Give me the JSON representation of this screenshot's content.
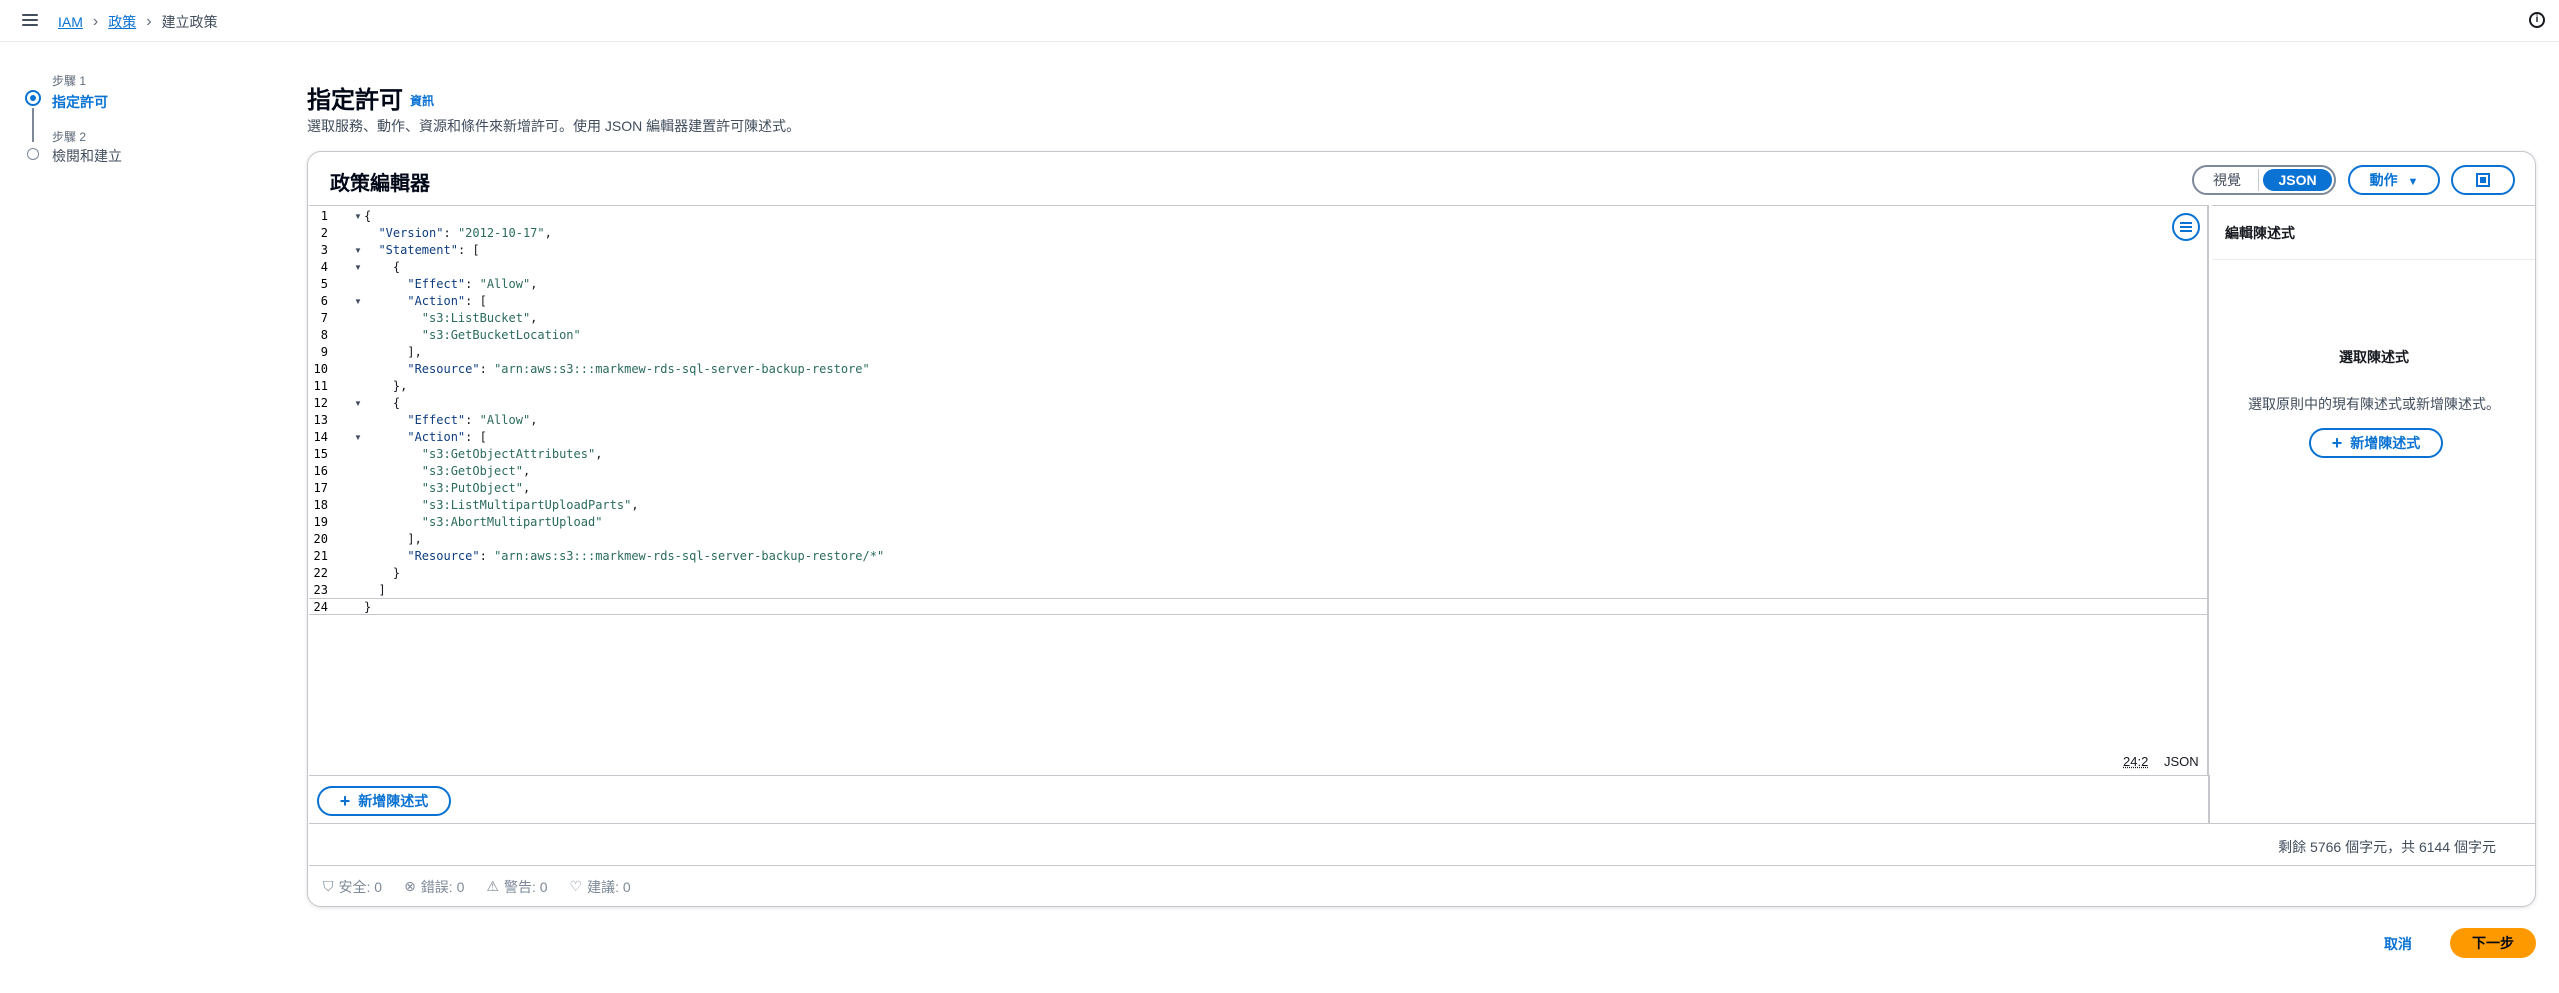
{
  "breadcrumbs": [
    "IAM",
    "政策",
    "建立政策"
  ],
  "steps": [
    {
      "num": "步驟 1",
      "title": "指定許可"
    },
    {
      "num": "步驟 2",
      "title": "檢閱和建立"
    }
  ],
  "header": {
    "title": "指定許可",
    "info": "資訊",
    "description": "選取服務、動作、資源和條件來新增許可。使用 JSON 編輯器建置許可陳述式。"
  },
  "editor": {
    "title": "政策編輯器",
    "mode_visual": "視覺",
    "mode_json": "JSON",
    "actions_label": "動作",
    "cursor": "24:2",
    "language": "JSON",
    "lines": [
      {
        "n": "1",
        "fold": true
      },
      {
        "n": "2"
      },
      {
        "n": "3",
        "fold": true
      },
      {
        "n": "4",
        "fold": true
      },
      {
        "n": "5"
      },
      {
        "n": "6",
        "fold": true
      },
      {
        "n": "7"
      },
      {
        "n": "8"
      },
      {
        "n": "9"
      },
      {
        "n": "10"
      },
      {
        "n": "11"
      },
      {
        "n": "12",
        "fold": true
      },
      {
        "n": "13"
      },
      {
        "n": "14",
        "fold": true
      },
      {
        "n": "15"
      },
      {
        "n": "16"
      },
      {
        "n": "17"
      },
      {
        "n": "18"
      },
      {
        "n": "19"
      },
      {
        "n": "20"
      },
      {
        "n": "21"
      },
      {
        "n": "22"
      },
      {
        "n": "23"
      },
      {
        "n": "24"
      }
    ],
    "code": {
      "l1": "{",
      "l2k": "\"Version\"",
      "l2v": "\"2012-10-17\"",
      "l3k": "\"Statement\"",
      "l5k": "\"Effect\"",
      "l5v": "\"Allow\"",
      "l6k": "\"Action\"",
      "l7": "\"s3:ListBucket\"",
      "l8": "\"s3:GetBucketLocation\"",
      "l10k": "\"Resource\"",
      "l10v": "\"arn:aws:s3:::markmew-rds-sql-server-backup-restore\"",
      "l13k": "\"Effect\"",
      "l13v": "\"Allow\"",
      "l14k": "\"Action\"",
      "l15": "\"s3:GetObjectAttributes\"",
      "l16": "\"s3:GetObject\"",
      "l17": "\"s3:PutObject\"",
      "l18": "\"s3:ListMultipartUploadParts\"",
      "l19": "\"s3:AbortMultipartUpload\"",
      "l21k": "\"Resource\"",
      "l21v": "\"arn:aws:s3:::markmew-rds-sql-server-backup-restore/*\"",
      "l24": "}"
    },
    "add_statement": "新增陳述式",
    "char_count": "剩餘 5766 個字元，共 6144 個字元",
    "stats": {
      "security": "安全: 0",
      "errors": "錯誤: 0",
      "warnings": "警告: 0",
      "suggestions": "建議: 0"
    }
  },
  "panel": {
    "title": "編輯陳述式",
    "empty_title": "選取陳述式",
    "empty_desc": "選取原則中的現有陳述式或新增陳述式。",
    "add_statement": "新增陳述式"
  },
  "footer": {
    "cancel": "取消",
    "next": "下一步"
  },
  "colors": {
    "accent": "#0972d3",
    "primary_button": "#ff9900"
  }
}
